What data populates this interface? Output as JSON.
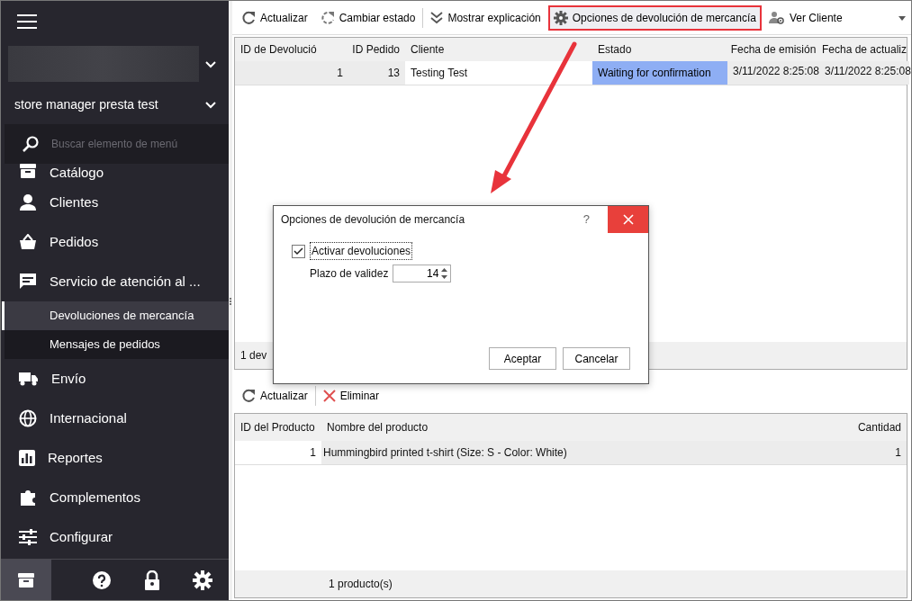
{
  "sidebar": {
    "store_name": "store manager presta test",
    "search": {
      "placeholder": "Buscar elemento de menú"
    },
    "items": [
      {
        "label": "Catálogo"
      },
      {
        "label": "Clientes"
      },
      {
        "label": "Pedidos"
      },
      {
        "label": "Servicio de atención al ...",
        "children": [
          {
            "label": "Devoluciones de mercancía",
            "selected": true
          },
          {
            "label": "Mensajes de pedidos",
            "selected": false
          }
        ]
      },
      {
        "label": "Envío"
      },
      {
        "label": "Internacional"
      },
      {
        "label": "Reportes"
      },
      {
        "label": "Complementos"
      },
      {
        "label": "Configurar"
      }
    ],
    "bottom_bar": [
      {
        "selected": true
      },
      {
        "selected": false
      },
      {
        "selected": false
      },
      {
        "selected": false
      }
    ]
  },
  "toolbar": {
    "buttons": [
      {
        "label": "Actualizar",
        "highlighted": false
      },
      {
        "label": "Cambiar estado",
        "highlighted": false
      },
      {
        "label": "Mostrar explicación",
        "highlighted": false
      },
      {
        "label": "Opciones de devolución de mercancía",
        "highlighted": true
      },
      {
        "label": "Ver Cliente",
        "highlighted": false
      }
    ]
  },
  "returns_table": {
    "columns": [
      "ID de Devolució",
      "ID Pedido",
      "Cliente",
      "Estado",
      "Fecha de emisión",
      "Fecha de actualiz"
    ],
    "rows": [
      {
        "selected": true,
        "cells": [
          {
            "text": "1",
            "focused": false
          },
          {
            "text": "13",
            "focused": false
          },
          {
            "text": "Testing Test",
            "focused": false
          },
          {
            "text": "Waiting for confirmation",
            "focused": true
          },
          {
            "text": "3/11/2022 8:25:08",
            "focused": false
          },
          {
            "text": "3/11/2022 8:25:08",
            "focused": false
          }
        ]
      }
    ],
    "status": "1 dev"
  },
  "dialog": {
    "title": "Opciones de devolución de mercancía",
    "help": "?",
    "checkbox": {
      "label": "Activar devoluciones",
      "checked": true
    },
    "spin": {
      "label": "Plazo de validez",
      "value": "14"
    },
    "buttons": [
      "Aceptar",
      "Cancelar"
    ]
  },
  "lower_toolbar": {
    "buttons": [
      "Actualizar",
      "Eliminar"
    ]
  },
  "products_table": {
    "columns": [
      "ID del Producto",
      "Nombre del producto",
      "Cantidad"
    ],
    "rows": [
      {
        "selected": true,
        "cells": [
          "1",
          "Hummingbird printed t-shirt (Size: S - Color: White)",
          "1"
        ]
      }
    ],
    "footer": "1 producto(s)"
  }
}
